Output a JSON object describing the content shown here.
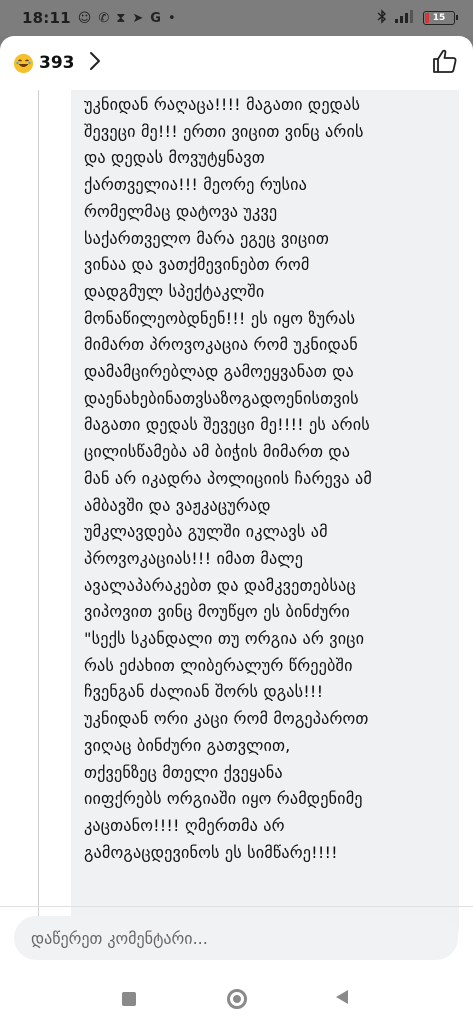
{
  "status_bar": {
    "time": "18:11",
    "left_icons": [
      "emoji-icon",
      "missed-call-icon",
      "hourglass-icon",
      "telegram-icon",
      "google-icon"
    ],
    "right_icons": [
      "bluetooth-icon",
      "signal-icon"
    ],
    "battery_level": "15",
    "battery_color": "#d8343a"
  },
  "header": {
    "reaction_icon": "laughing-emoji",
    "reaction_count": "393",
    "like_icon": "thumbs-up-icon"
  },
  "comment": {
    "lines": [
      "უკნიდან რაღაცა!!!! მაგათი დედას",
      "შევეცი მე!!! ერთი ვიცით ვინც არის",
      "და დედას მოვუტყნავთ",
      "ქართველია!!! მეორე რუსია",
      "რომელმაც დატოვა უკვე",
      "საქართველო მარა ეგეც ვიცით",
      "ვინაა და ვათქმევინებთ რომ",
      "დადგმულ სპექტაკლში",
      "მონაწილეობდნენ!!! ეს იყო ზურას",
      "მიმართ პროვოკაცია რომ უკნიდან",
      "დამამცირებლად გამოეყვანათ და",
      "დაენახებინათვსაზოგადოენისთვის",
      "მაგათი დედას შევეცი მე!!!! ეს არის",
      "ცილისწამება ამ ბიჭის მიმართ და",
      "მან არ იკადრა პოლიციის ჩარევა ამ",
      "ამბავში და ვაჟკაცურად",
      "უმკლავდება გულში იკლავს ამ",
      "პროვოკაციას!!! იმათ მალე",
      "ავალაპარაკებთ და დამკვეთებსაც",
      "ვიპოვით ვინც მოუწყო ეს ბინძური",
      "\"სექს სკანდალი თუ ორგია არ ვიცი",
      "რას ეძახით ლიბერალურ წრეებში",
      "ჩვენგან ძალიან შორს დგას!!!",
      "უკნიდან ორი კაცი რომ მოგეპაროთ",
      "ვიღაც ბინძური გათვლით,",
      "თქვენზეც მთელი ქვეყანა",
      "იიფქრებს ორგიაში იყო რამდენიმე",
      "კაცთანო!!!! ღმერთმა არ",
      "გამოგაცდევინოს ეს სიმწარე!!!!"
    ]
  },
  "composer": {
    "placeholder": "დაწერეთ კომენტარი..."
  },
  "nav": {
    "recents_icon": "square-icon",
    "home_icon": "circle-icon",
    "back_icon": "triangle-back-icon"
  }
}
